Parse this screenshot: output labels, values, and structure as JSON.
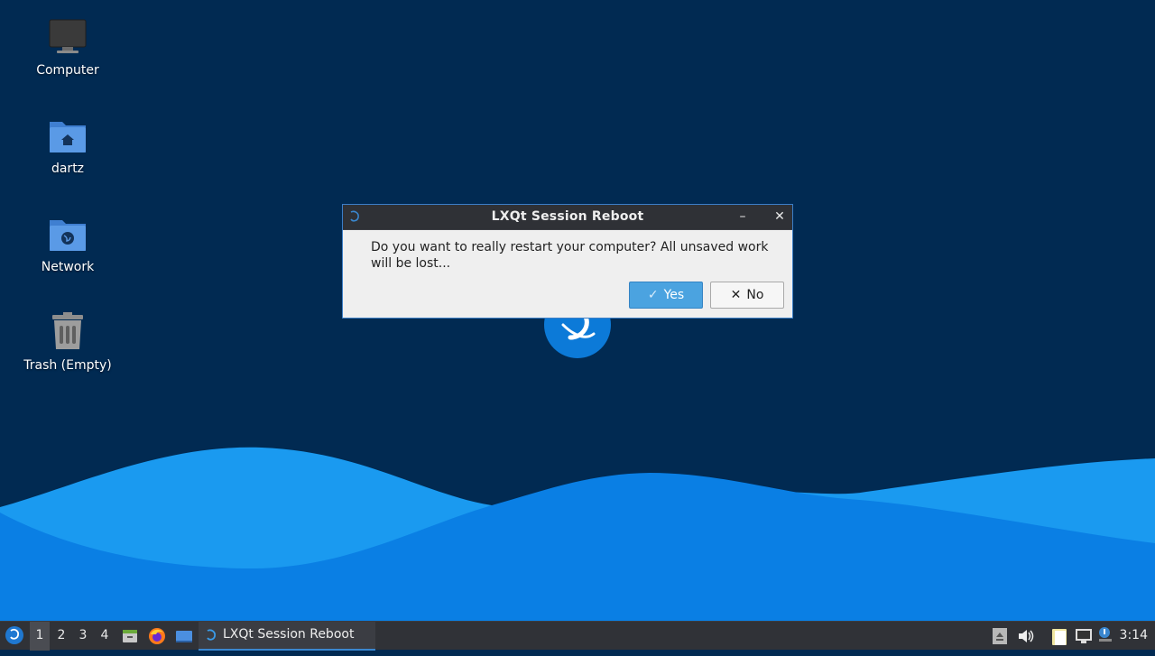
{
  "desktop": {
    "icons": [
      {
        "label": "Computer"
      },
      {
        "label": "dartz"
      },
      {
        "label": "Network"
      },
      {
        "label": "Trash (Empty)"
      }
    ]
  },
  "dialog": {
    "title": "LXQt Session Reboot",
    "message": "Do you want to really restart your computer? All unsaved work will be lost...",
    "yes_label": "Yes",
    "no_label": "No",
    "minimize_glyph": "–",
    "close_glyph": "✕"
  },
  "taskbar": {
    "desktops": [
      "1",
      "2",
      "3",
      "4"
    ],
    "active_desktop": "1",
    "task_label": "LXQt Session Reboot",
    "clock": "3:14"
  },
  "colors": {
    "desktop_bg": "#012a52",
    "wave_light": "#1a9af0",
    "wave_dark": "#0a79e0",
    "accent": "#3a87cf",
    "taskbar_bg": "#303237"
  }
}
